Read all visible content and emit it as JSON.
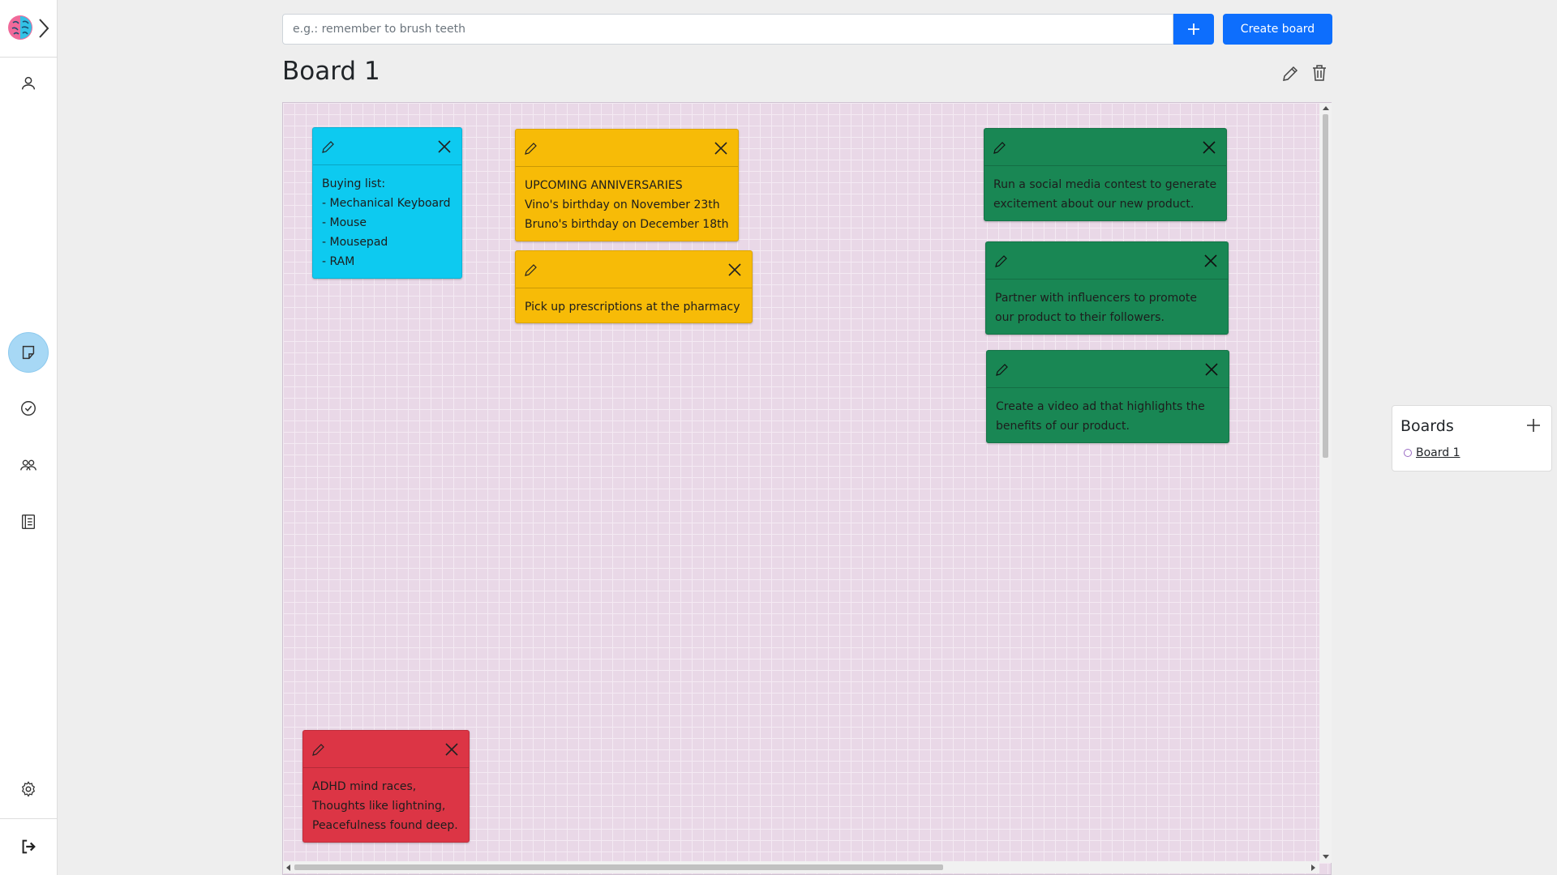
{
  "toolbar": {
    "task_placeholder": "e.g.: remember to brush teeth",
    "create_board_label": "Create board"
  },
  "board": {
    "title": "Board 1"
  },
  "notes": [
    {
      "color": "blue",
      "text": "Buying list:\n- Mechanical Keyboard\n- Mouse\n- Mousepad\n- RAM"
    },
    {
      "color": "yellow",
      "text": "UPCOMING ANNIVERSARIES\nVino's birthday on November 23th\nBruno's birthday on December 18th"
    },
    {
      "color": "yellow",
      "text": "Pick up prescriptions at the pharmacy"
    },
    {
      "color": "green",
      "text": "Run a social media contest to generate\nexcitement about our new product."
    },
    {
      "color": "green",
      "text": "Partner with influencers to promote\nour product to their followers."
    },
    {
      "color": "green",
      "text": "Create a video ad that highlights the\nbenefits of our product."
    },
    {
      "color": "red",
      "text": "ADHD mind races,\nThoughts like lightning,\nPeacefulness found deep."
    }
  ],
  "boards_panel": {
    "title": "Boards",
    "items": [
      {
        "label": "Board 1"
      }
    ]
  },
  "sidebar": {
    "icons": [
      "brain-logo-icon",
      "chevron-right-icon",
      "user-icon",
      "sticky-note-icon",
      "check-circle-icon",
      "people-icon",
      "list-icon",
      "gear-icon",
      "logout-icon"
    ]
  },
  "colors": {
    "primary": "#0d6efd",
    "note_blue": "#0dcaf0",
    "note_yellow": "#f7bb07",
    "note_green": "#198754",
    "note_red": "#dc3545",
    "board_bg": "#e9d8e7"
  }
}
